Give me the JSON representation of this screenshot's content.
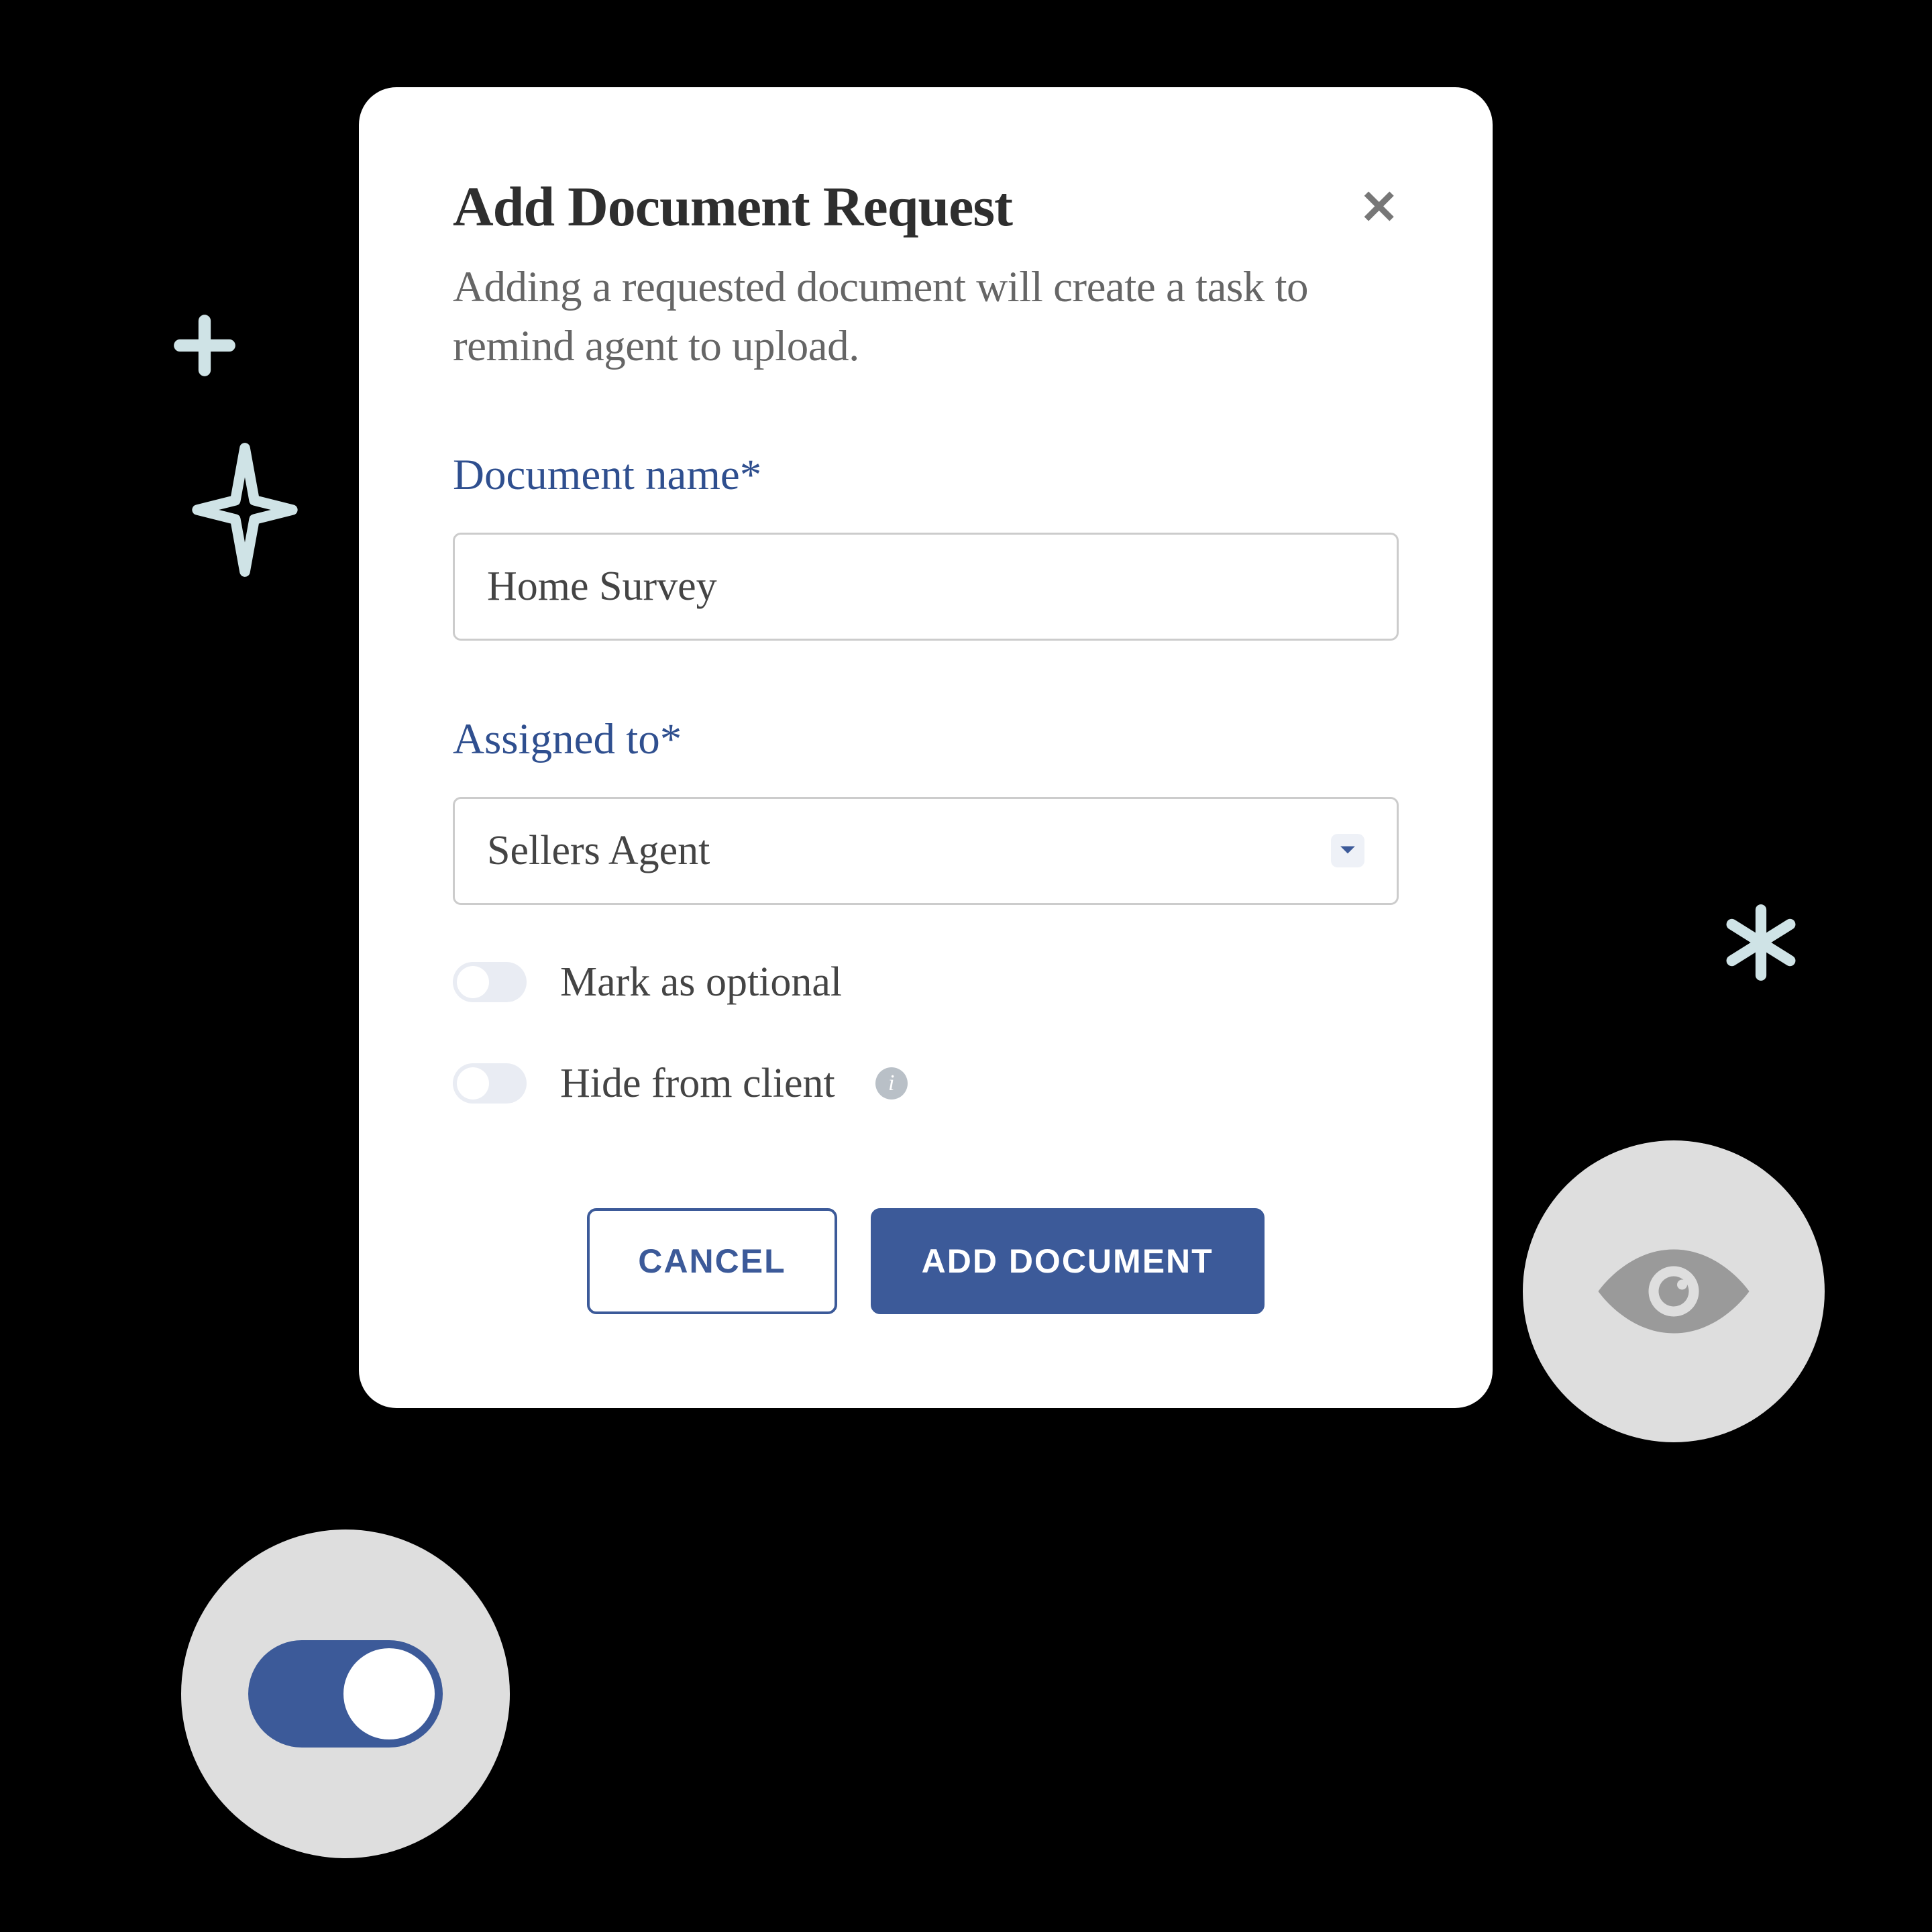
{
  "modal": {
    "title": "Add Document Request",
    "description": "Adding a requested document will create a task to remind agent to upload.",
    "close_label": "✕"
  },
  "fields": {
    "document_name": {
      "label": "Document name*",
      "value": "Home Survey"
    },
    "assigned_to": {
      "label": "Assigned to*",
      "selected": "Sellers Agent"
    }
  },
  "toggles": {
    "mark_optional": {
      "label": "Mark as optional",
      "on": false
    },
    "hide_from_client": {
      "label": "Hide from client",
      "on": false
    }
  },
  "buttons": {
    "cancel": "CANCEL",
    "submit": "ADD DOCUMENT"
  },
  "info_glyph": "i",
  "colors": {
    "primary": "#3c5a99",
    "label_blue": "#2f4f8f",
    "toggle_off_bg": "#e9ecf3",
    "deco_stroke": "#cfe3e6"
  }
}
